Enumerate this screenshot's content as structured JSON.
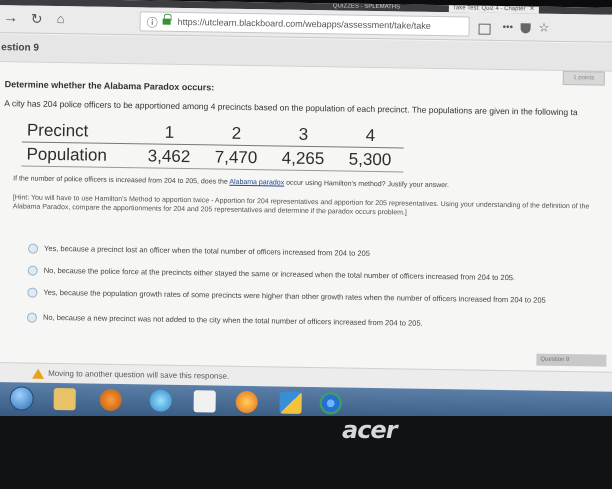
{
  "browser": {
    "tabs": [
      {
        "label": "QUIZZES - SPLEMATHS",
        "active": false
      },
      {
        "label": "Take Test: Quiz 4 - Chapter",
        "active": true
      }
    ],
    "url": "https://utclearn.blackboard.com/webapps/assessment/take/take",
    "icons": [
      "forward-arrow-icon",
      "reload-icon",
      "home-icon",
      "info-icon",
      "lock-icon",
      "reader-icon",
      "more-icon",
      "pocket-icon",
      "star-icon"
    ]
  },
  "header": {
    "title": "estion 9"
  },
  "points_label": "1 points",
  "prompt": "Determine whether the Alabama Paradox occurs:",
  "stem": "A city has 204 police officers to be apportioned among 4 precincts based on the population of each precinct. The populations are given in the following ta",
  "table": {
    "row1_label": "Precinct",
    "row2_label": "Population",
    "precincts": [
      "1",
      "2",
      "3",
      "4"
    ],
    "populations": [
      "3,462",
      "7,470",
      "4,265",
      "5,300"
    ]
  },
  "question": {
    "before": "If the number of police officers is increased from 204 to 205, does the ",
    "link": "Alabama paradox",
    "after": " occur using Hamilton's method? Justify your answer."
  },
  "hint": "[Hint:  You will have to use Hamilton's Method to apportion twice - Apportion for 204 representatives and apportion for 205 representatives.  Using your understanding of the definition of the Alabama Paradox, compare the apportionments for 204 and 205 representatives and determine if the paradox occurs problem.]",
  "choices": [
    "Yes, because a precinct lost an officer when the total number of officers increased from 204 to 205",
    "No, because the police force at the precincts either stayed the same or increased when the total number of officers increased from 204 to 205.",
    "Yes, because the population growth rates of some precincts were higher than other growth rates when the number of officers increased from 204 to 205",
    "No, because a new precinct was not added to the city when the total number of officers increased from 204 to 205."
  ],
  "question_nav": "Question 9",
  "status": {
    "warning": "Moving to another question will save this response."
  },
  "taskbar": {
    "icons": [
      "windows-start-icon",
      "file-explorer-icon",
      "media-player-icon",
      "internet-explorer-icon",
      "paint-icon",
      "firefox-icon",
      "security-shield-icon",
      "chrome-icon"
    ]
  },
  "monitor": {
    "brand": "acer"
  },
  "colors": {
    "link": "#22488a",
    "warning": "#e7a21b",
    "taskbar": "#4a6e96"
  }
}
